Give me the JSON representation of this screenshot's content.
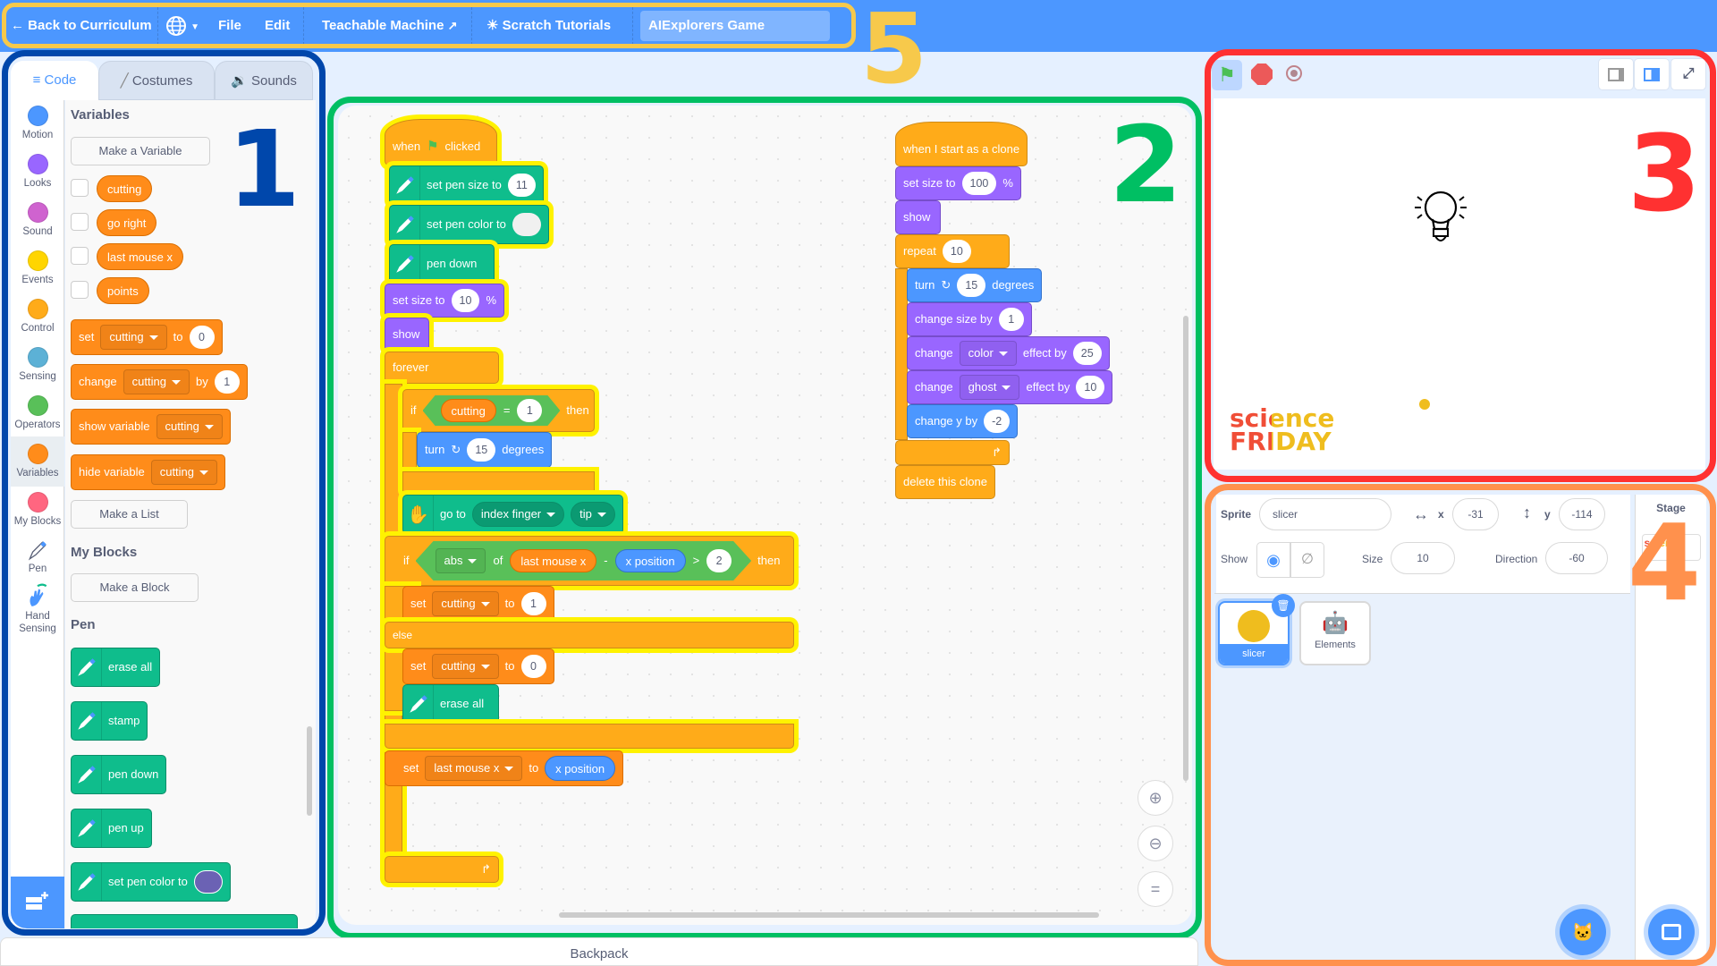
{
  "menubar": {
    "back": "Back to Curriculum",
    "language_icon": "globe-icon",
    "file": "File",
    "edit": "Edit",
    "teachable": "Teachable Machine",
    "tutorials": "Scratch Tutorials",
    "project_title": "AIExplorers Game"
  },
  "annotations": {
    "n1": "1",
    "n2": "2",
    "n3": "3",
    "n4": "4",
    "n5": "5"
  },
  "annotation_colors": {
    "n1": "#0047ab",
    "n2": "#00bf63",
    "n3": "#ff3131",
    "n4": "#ff914d",
    "n5": "#f7c94b"
  },
  "tabs": {
    "code": "Code",
    "costumes": "Costumes",
    "sounds": "Sounds"
  },
  "categories": [
    {
      "label": "Motion",
      "color": "#4c97ff"
    },
    {
      "label": "Looks",
      "color": "#9966ff"
    },
    {
      "label": "Sound",
      "color": "#cf63cf"
    },
    {
      "label": "Events",
      "color": "#ffd500"
    },
    {
      "label": "Control",
      "color": "#ffab19"
    },
    {
      "label": "Sensing",
      "color": "#5cb1d6"
    },
    {
      "label": "Operators",
      "color": "#59c059"
    },
    {
      "label": "Variables",
      "color": "#ff8c1a"
    },
    {
      "label": "My Blocks",
      "color": "#ff6680"
    },
    {
      "label": "Pen",
      "color": ""
    },
    {
      "label": "Hand Sensing",
      "color": ""
    }
  ],
  "palette": {
    "variables_heading": "Variables",
    "make_variable": "Make a Variable",
    "variables": [
      "cutting",
      "go right",
      "last mouse x",
      "points"
    ],
    "set_block": {
      "op": "set",
      "var": "cutting",
      "to": "to",
      "value": "0"
    },
    "change_block": {
      "op": "change",
      "var": "cutting",
      "by": "by",
      "value": "1"
    },
    "show_var": {
      "op": "show variable",
      "var": "cutting"
    },
    "hide_var": {
      "op": "hide variable",
      "var": "cutting"
    },
    "make_list": "Make a List",
    "myblocks_heading": "My Blocks",
    "make_block": "Make a Block",
    "pen_heading": "Pen",
    "pen_blocks": [
      "erase all",
      "stamp",
      "pen down",
      "pen up",
      "set pen color to"
    ],
    "pen_color_swatch": "#6b62b4"
  },
  "script1": {
    "hat": {
      "when": "when",
      "clicked": "clicked"
    },
    "set_pen_size": {
      "label": "set pen size to",
      "value": "11"
    },
    "set_pen_color": {
      "label": "set pen color to",
      "value": "#f0f0f0"
    },
    "pen_down": "pen down",
    "set_size": {
      "label": "set size to",
      "value": "10",
      "unit": "%"
    },
    "show": "show",
    "forever": "forever",
    "if1": {
      "if": "if",
      "var": "cutting",
      "op": "=",
      "value": "1",
      "then": "then"
    },
    "turn": {
      "label": "turn",
      "value": "15",
      "unit": "degrees"
    },
    "goto": {
      "label": "go to",
      "part": "index finger",
      "point": "tip"
    },
    "if2": {
      "if": "if",
      "fn": "abs",
      "of": "of",
      "var": "last mouse x",
      "minus": "-",
      "rep": "x position",
      "gt": ">",
      "value": "2",
      "then": "then"
    },
    "set_cut_1": {
      "op": "set",
      "var": "cutting",
      "to": "to",
      "value": "1"
    },
    "else": "else",
    "set_cut_0": {
      "op": "set",
      "var": "cutting",
      "to": "to",
      "value": "0"
    },
    "erase_all": "erase all",
    "set_last": {
      "op": "set",
      "var": "last mouse x",
      "to": "to",
      "rep": "x position"
    }
  },
  "script2": {
    "hat": "when I start as a clone",
    "set_size": {
      "label": "set size to",
      "value": "100",
      "unit": "%"
    },
    "show": "show",
    "repeat": {
      "label": "repeat",
      "value": "10"
    },
    "turn": {
      "label": "turn",
      "value": "15",
      "unit": "degrees"
    },
    "change_size": {
      "label": "change size by",
      "value": "1"
    },
    "change_color": {
      "label": "change",
      "effect": "color",
      "by": "effect by",
      "value": "25"
    },
    "change_ghost": {
      "label": "change",
      "effect": "ghost",
      "by": "effect by",
      "value": "10"
    },
    "change_y": {
      "label": "change y by",
      "value": "-2"
    },
    "delete": "delete this clone"
  },
  "stage": {
    "logo_line1": "science",
    "logo_line2": "FRIDAY"
  },
  "sprite_info": {
    "sprite_label": "Sprite",
    "sprite_name": "slicer",
    "x_label": "x",
    "x": "-31",
    "y_label": "y",
    "y": "-114",
    "show_label": "Show",
    "size_label": "Size",
    "size": "10",
    "direction_label": "Direction",
    "direction": "-60"
  },
  "sprites": [
    {
      "name": "slicer",
      "selected": true
    },
    {
      "name": "Elements",
      "selected": false
    }
  ],
  "stage_panel": {
    "label": "Stage"
  },
  "backpack": "Backpack"
}
